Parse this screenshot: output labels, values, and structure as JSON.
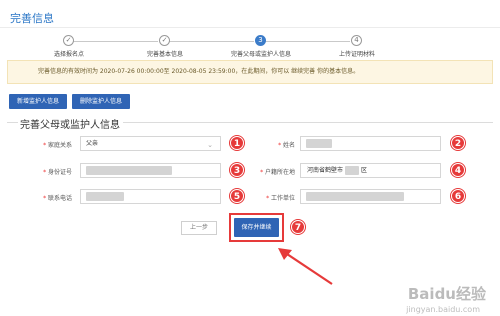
{
  "page": {
    "title": "完善信息"
  },
  "steps": [
    {
      "label": "选择报名点",
      "number": "✓",
      "state": "done"
    },
    {
      "label": "完善基本信息",
      "number": "✓",
      "state": "done"
    },
    {
      "label": "完善父母或监护人信息",
      "number": "3",
      "state": "active"
    },
    {
      "label": "上传证明材料",
      "number": "4",
      "state": "todo"
    }
  ],
  "notice": {
    "text": "完善信息的有效时间为 2020-07-26 00:00:00至 2020-08-05 23:59:00，在此期间，你可以 继续完善 你的基本信息。"
  },
  "toolbar": {
    "add_label": "新增监护人信息",
    "delete_label": "删除监护人信息"
  },
  "section": {
    "title": "完善父母或监护人信息"
  },
  "form": {
    "relation": {
      "label": "家庭关系",
      "value": "父亲"
    },
    "name": {
      "label": "姓名",
      "value": ""
    },
    "id_number": {
      "label": "身份证号",
      "value": ""
    },
    "hukou": {
      "label": "户籍所在地",
      "value": "河南省鹤壁市",
      "suffix": "区"
    },
    "phone": {
      "label": "联系电话",
      "value": ""
    },
    "employer": {
      "label": "工作单位",
      "value": ""
    }
  },
  "actions": {
    "prev_label": "上一步",
    "save_label": "保存并继续"
  },
  "annotations": [
    "1",
    "2",
    "3",
    "4",
    "5",
    "6",
    "7"
  ],
  "watermark": {
    "text": "Baidu经验",
    "sub": "jingyan.baidu.com"
  },
  "colors": {
    "primary": "#2f64b5",
    "annotation": "#e63a3a",
    "title": "#2a76c6"
  }
}
